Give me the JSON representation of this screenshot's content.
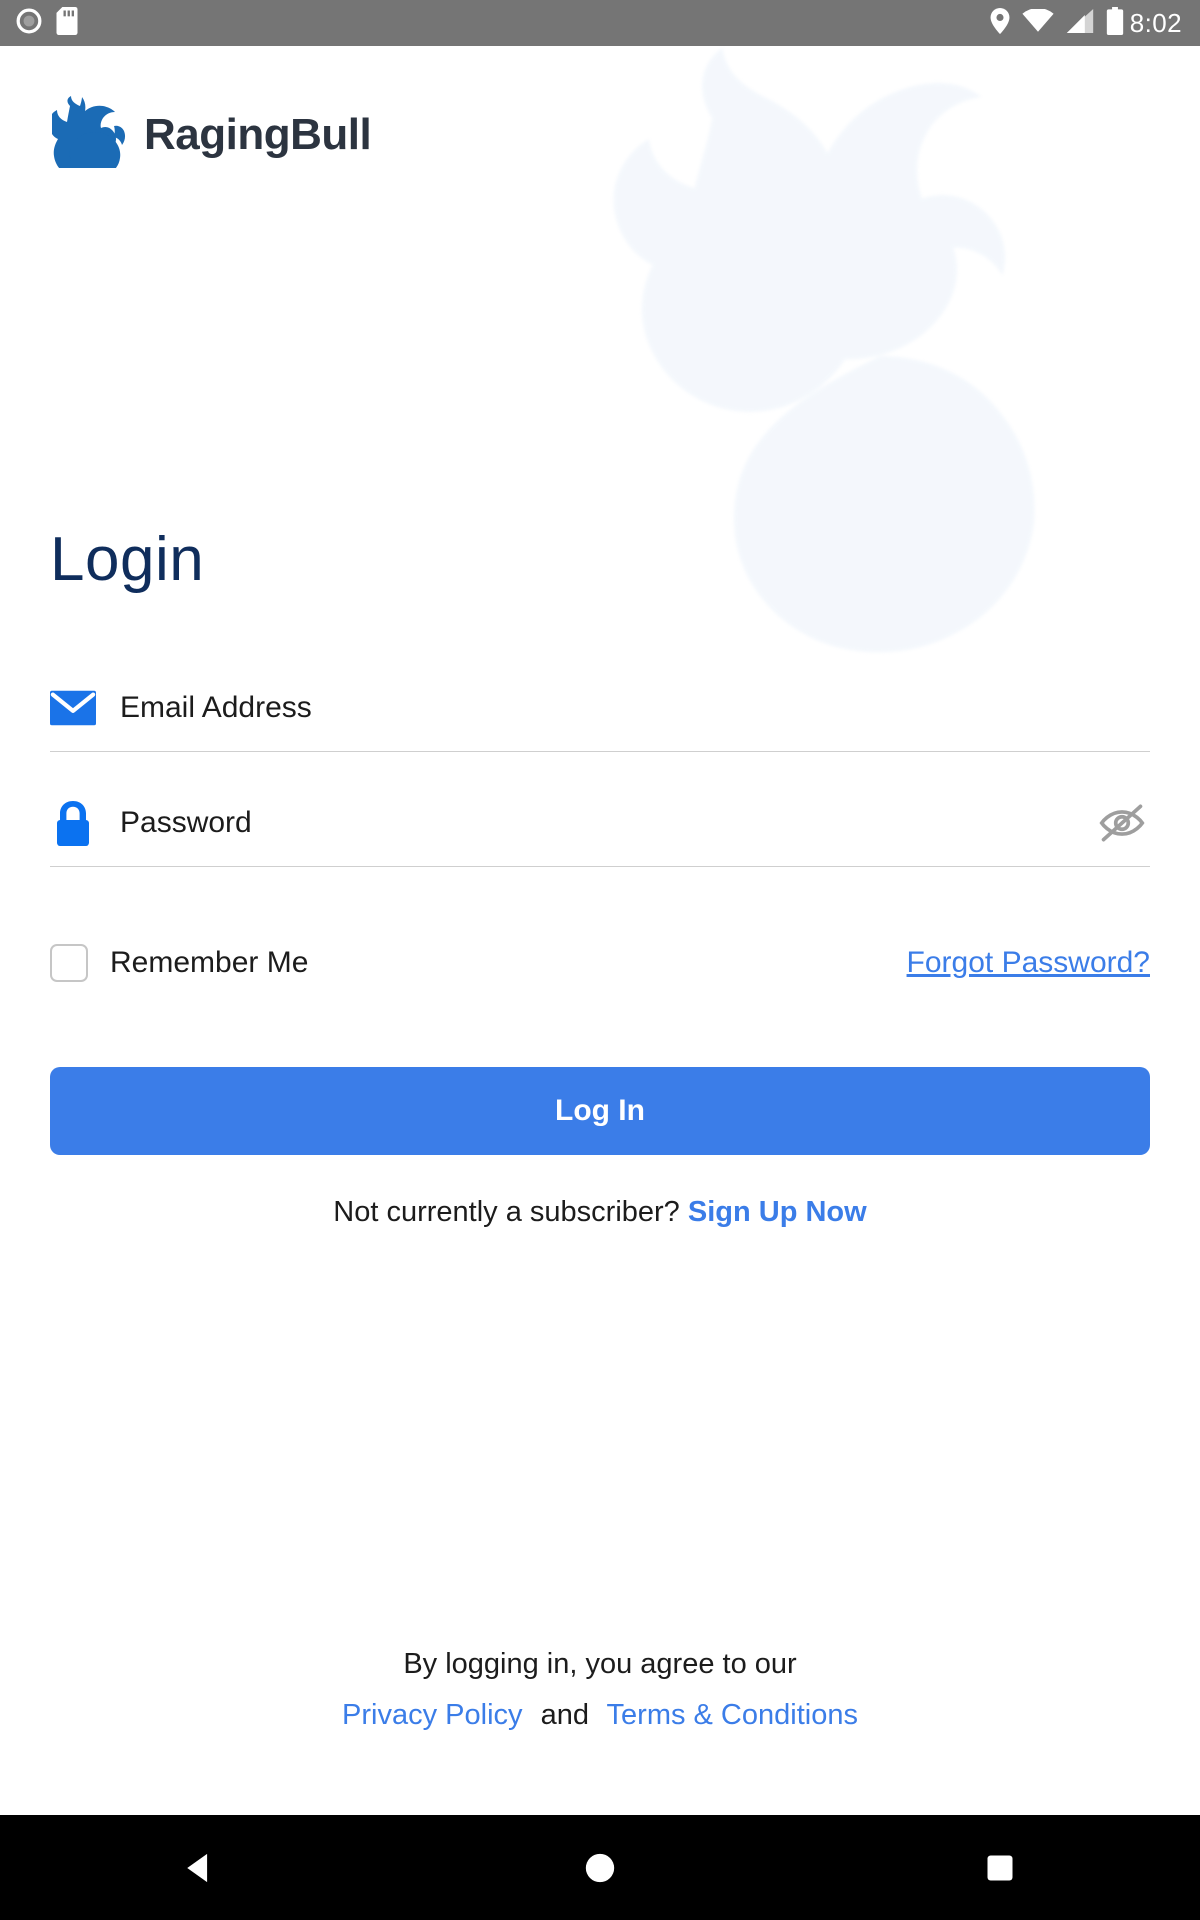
{
  "status_bar": {
    "time": "8:02",
    "left_icons": [
      "record-circle-icon",
      "sd-card-icon"
    ],
    "right_icons": [
      "location-pin-icon",
      "wifi-icon",
      "cellular-signal-icon",
      "battery-icon"
    ],
    "background": "#757575"
  },
  "brand": {
    "name": "RagingBull",
    "logo_icon": "bull-logo-icon",
    "logo_color": "#1b6bb5",
    "wordmark_color": "#2c3440"
  },
  "page": {
    "title": "Login",
    "title_color": "#0f2d5c"
  },
  "form": {
    "email": {
      "placeholder": "Email Address",
      "value": "",
      "icon": "envelope-icon"
    },
    "password": {
      "placeholder": "Password",
      "value": "",
      "icon": "lock-icon",
      "visibility_icon": "eye-off-icon",
      "visible": false
    },
    "remember_me": {
      "label": "Remember Me",
      "checked": false
    },
    "forgot_password": "Forgot Password?",
    "submit_label": "Log In"
  },
  "signup": {
    "prompt": "Not currently a subscriber?",
    "link": "Sign Up Now"
  },
  "footer": {
    "agreement": "By logging in, you agree to our",
    "privacy_policy": "Privacy Policy",
    "and": "and",
    "terms": "Terms & Conditions"
  },
  "nav_bar": {
    "back": "back-triangle-icon",
    "home": "home-circle-icon",
    "recents": "recents-square-icon"
  },
  "colors": {
    "accent_blue": "#3b7de8",
    "icon_blue": "#1a73e8",
    "navy": "#0f2d5c"
  }
}
